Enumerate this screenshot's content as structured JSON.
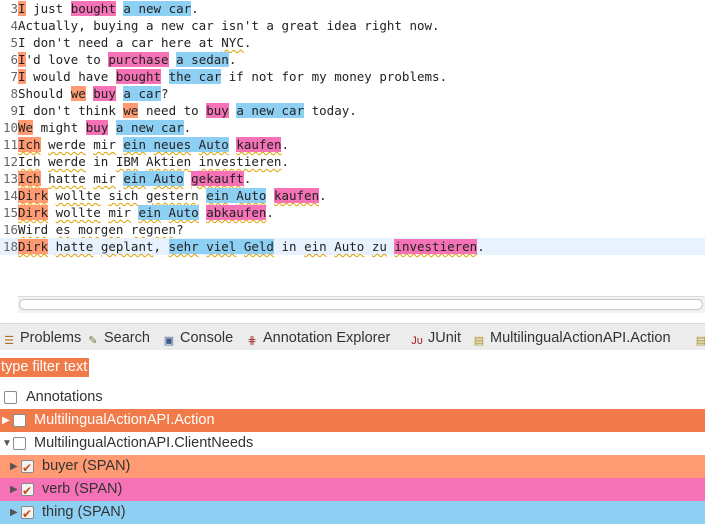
{
  "editor": {
    "lines": [
      {
        "n": "3",
        "segs": [
          {
            "t": "I",
            "c": "b"
          },
          {
            "t": " just "
          },
          {
            "t": "bought",
            "c": "v"
          },
          {
            "t": " "
          },
          {
            "t": "a new car",
            "c": "t"
          },
          {
            "t": "."
          }
        ]
      },
      {
        "n": "4",
        "segs": [
          {
            "t": "Actually, buying a new car isn't a great idea right now."
          }
        ]
      },
      {
        "n": "5",
        "segs": [
          {
            "t": "I don't need a car here at NYC."
          }
        ]
      },
      {
        "n": "6",
        "segs": [
          {
            "t": "I",
            "c": "b"
          },
          {
            "t": "'d love to "
          },
          {
            "t": "purchase",
            "c": "v"
          },
          {
            "t": " "
          },
          {
            "t": "a sedan",
            "c": "t"
          },
          {
            "t": "."
          }
        ]
      },
      {
        "n": "7",
        "segs": [
          {
            "t": "I",
            "c": "b"
          },
          {
            "t": " would have "
          },
          {
            "t": "bought",
            "c": "v"
          },
          {
            "t": " "
          },
          {
            "t": "the car",
            "c": "t"
          },
          {
            "t": " if not for my money problems."
          }
        ]
      },
      {
        "n": "8",
        "segs": [
          {
            "t": "Should "
          },
          {
            "t": "we",
            "c": "b"
          },
          {
            "t": " "
          },
          {
            "t": "buy",
            "c": "v"
          },
          {
            "t": " "
          },
          {
            "t": "a car",
            "c": "t"
          },
          {
            "t": "?"
          }
        ]
      },
      {
        "n": "9",
        "segs": [
          {
            "t": "I don't think "
          },
          {
            "t": "we",
            "c": "b"
          },
          {
            "t": " need to "
          },
          {
            "t": "buy",
            "c": "v"
          },
          {
            "t": " "
          },
          {
            "t": "a new car",
            "c": "t"
          },
          {
            "t": " today."
          }
        ]
      },
      {
        "n": "10",
        "segs": [
          {
            "t": "We",
            "c": "b"
          },
          {
            "t": " might "
          },
          {
            "t": "buy",
            "c": "v"
          },
          {
            "t": " "
          },
          {
            "t": "a new car",
            "c": "t"
          },
          {
            "t": "."
          }
        ]
      },
      {
        "n": "11",
        "segs": [
          {
            "t": "Ich",
            "c": "b"
          },
          {
            "t": " werde mir "
          },
          {
            "t": "ein neues Auto",
            "c": "t"
          },
          {
            "t": " "
          },
          {
            "t": "kaufen",
            "c": "v"
          },
          {
            "t": "."
          }
        ]
      },
      {
        "n": "12",
        "segs": [
          {
            "t": "Ich werde in IBM Aktien investieren."
          }
        ]
      },
      {
        "n": "13",
        "segs": [
          {
            "t": "Ich",
            "c": "b"
          },
          {
            "t": " hatte mir "
          },
          {
            "t": "ein Auto",
            "c": "t"
          },
          {
            "t": " "
          },
          {
            "t": "gekauft",
            "c": "v"
          },
          {
            "t": "."
          }
        ]
      },
      {
        "n": "14",
        "segs": [
          {
            "t": "Dirk",
            "c": "b"
          },
          {
            "t": " wollte sich gestern "
          },
          {
            "t": "ein Auto",
            "c": "t"
          },
          {
            "t": " "
          },
          {
            "t": "kaufen",
            "c": "v"
          },
          {
            "t": "."
          }
        ]
      },
      {
        "n": "15",
        "segs": [
          {
            "t": "Dirk",
            "c": "b"
          },
          {
            "t": " wollte mir "
          },
          {
            "t": "ein Auto",
            "c": "t"
          },
          {
            "t": " "
          },
          {
            "t": "abkaufen",
            "c": "v"
          },
          {
            "t": "."
          }
        ]
      },
      {
        "n": "16",
        "segs": [
          {
            "t": "Wird es morgen regnen?"
          }
        ]
      },
      {
        "n": "18",
        "segs": [
          {
            "t": "Dirk",
            "c": "b"
          },
          {
            "t": " hatte geplant, "
          },
          {
            "t": "sehr viel Geld",
            "c": "t"
          },
          {
            "t": " in ein Auto zu "
          },
          {
            "t": "investieren",
            "c": "v"
          },
          {
            "t": "."
          }
        ],
        "current": true
      }
    ]
  },
  "tabs": [
    {
      "label": "Problems",
      "icon": "problems-icon",
      "glyph": "☰",
      "color": "#b07020"
    },
    {
      "label": "Search",
      "icon": "search-icon",
      "glyph": "✎",
      "color": "#7a7a40"
    },
    {
      "label": "Console",
      "icon": "console-icon",
      "glyph": "▣",
      "color": "#3a5a90"
    },
    {
      "label": "Annotation Explorer",
      "icon": "annotation-explorer-icon",
      "glyph": "⋕",
      "color": "#a03030"
    },
    {
      "label": "JUnit",
      "icon": "junit-icon",
      "glyph": "Jᴜ",
      "color": "#a02020"
    },
    {
      "label": "MultilingualActionAPI.Action",
      "icon": "tag-icon",
      "glyph": "▤",
      "color": "#b09020"
    },
    {
      "label": "",
      "icon": "more-tabs-icon",
      "glyph": "▤",
      "color": "#b09020"
    }
  ],
  "filter": {
    "placeholder": "type filter text"
  },
  "tree": {
    "root_label": "Annotations",
    "rows": [
      {
        "label": "MultilingualActionAPI.Action",
        "expanded": false,
        "checked": false,
        "bg": "#f07a4a",
        "fg": "#ffffff",
        "indent": 0
      },
      {
        "label": "MultilingualActionAPI.ClientNeeds",
        "expanded": true,
        "checked": false,
        "bg": "#ffffff",
        "fg": "#333333",
        "indent": 0
      },
      {
        "label": "buyer (SPAN)",
        "expanded": false,
        "checked": true,
        "bg": "#ff9a72",
        "fg": "#333333",
        "indent": 1
      },
      {
        "label": "verb (SPAN)",
        "expanded": false,
        "checked": true,
        "bg": "#f572b6",
        "fg": "#333333",
        "indent": 1
      },
      {
        "label": "thing (SPAN)",
        "expanded": false,
        "checked": true,
        "bg": "#8ecff4",
        "fg": "#333333",
        "indent": 1
      }
    ]
  },
  "colors": {
    "buyer": "#ff9a72",
    "verb": "#f572b6",
    "thing": "#8ecff4",
    "accent": "#f07a4a"
  }
}
